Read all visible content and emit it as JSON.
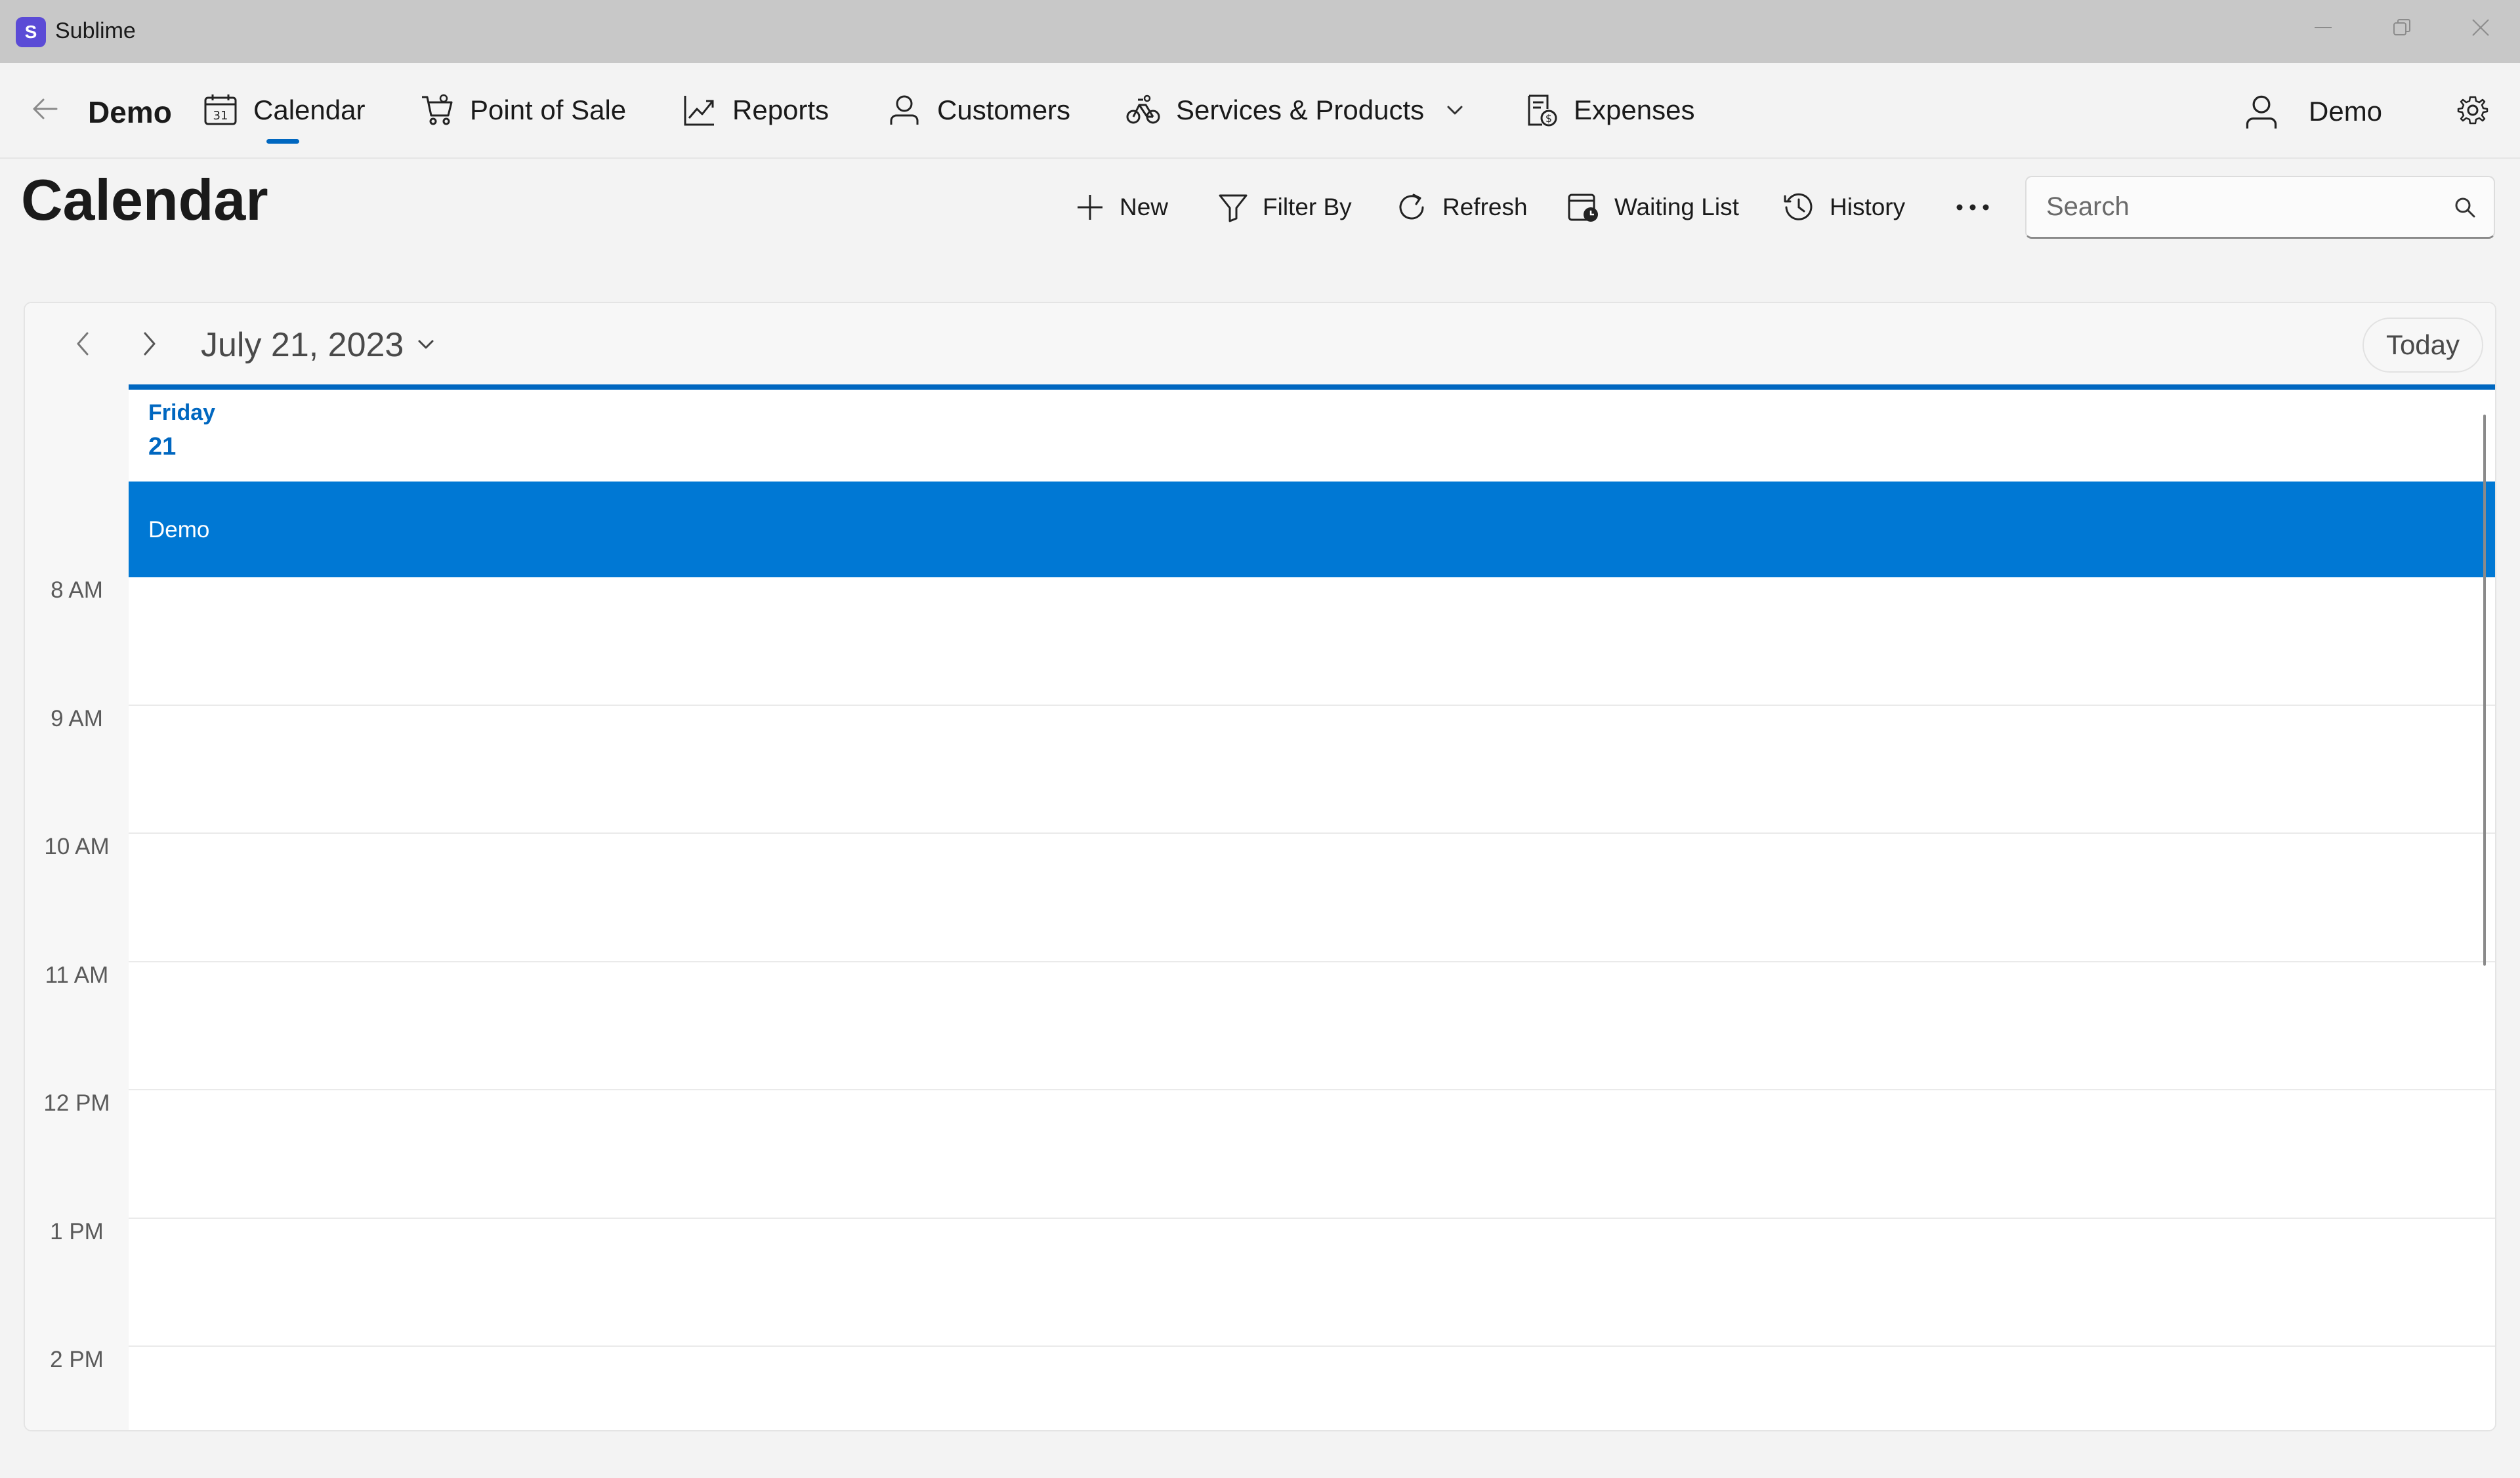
{
  "window": {
    "app_logo": "S",
    "app_title": "Sublime",
    "controls": [
      "minimize-icon",
      "restore-icon",
      "close-icon"
    ]
  },
  "nav": {
    "back_icon": "back-arrow-icon",
    "business_name": "Demo",
    "items": [
      {
        "label": "Calendar",
        "icon": "calendar-icon",
        "selected": true
      },
      {
        "label": "Point of Sale",
        "icon": "cart-icon"
      },
      {
        "label": "Reports",
        "icon": "chart-icon"
      },
      {
        "label": "Customers",
        "icon": "person-icon"
      },
      {
        "label": "Services & Products",
        "icon": "bicycle-icon",
        "has_dropdown": true
      },
      {
        "label": "Expenses",
        "icon": "receipt-icon"
      }
    ],
    "user_name": "Demo",
    "settings_icon": "gear-icon"
  },
  "page": {
    "title": "Calendar"
  },
  "commands": [
    {
      "label": "New",
      "icon": "plus-icon"
    },
    {
      "label": "Filter By",
      "icon": "filter-icon"
    },
    {
      "label": "Refresh",
      "icon": "refresh-icon"
    },
    {
      "label": "Waiting List",
      "icon": "waiting-list-icon"
    },
    {
      "label": "History",
      "icon": "history-icon"
    }
  ],
  "more_icon": "more-icon",
  "search": {
    "placeholder": "Search",
    "value": ""
  },
  "calendar": {
    "date_label": "July 21, 2023",
    "today_label": "Today",
    "day": {
      "name": "Friday",
      "number": "21"
    },
    "resource": "Demo",
    "hours": [
      "8 AM",
      "9 AM",
      "10 AM",
      "11 AM",
      "12 PM",
      "1 PM",
      "2 PM"
    ]
  },
  "colors": {
    "accent": "#0067c0",
    "resource_band": "#0078d4",
    "logo": "#5b4bd6"
  }
}
